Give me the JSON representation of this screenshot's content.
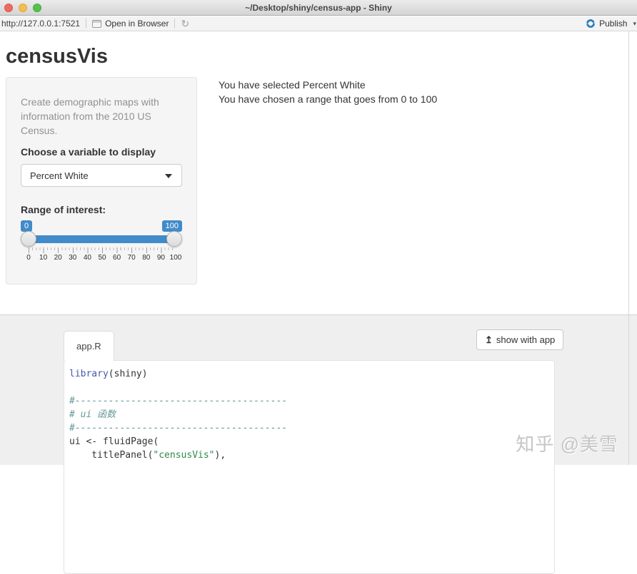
{
  "window": {
    "title": "~/Desktop/shiny/census-app - Shiny"
  },
  "toolbar": {
    "url": "http://127.0.0.1:7521",
    "open_in_browser_label": "Open in Browser",
    "refresh_icon": "↻",
    "publish_label": "Publish",
    "publish_caret": "▾"
  },
  "app": {
    "title": "censusVis",
    "sidebar": {
      "help_text": "Create demographic maps with information from the 2010 US Census.",
      "choose_label": "Choose a variable to display",
      "select_value": "Percent White",
      "range_label": "Range of interest:",
      "slider": {
        "min_badge": "0",
        "max_badge": "100",
        "ticks": [
          "0",
          "10",
          "20",
          "30",
          "40",
          "50",
          "60",
          "70",
          "80",
          "90",
          "100"
        ]
      }
    },
    "main": {
      "selected_line": "You have selected Percent White",
      "range_line": "You have chosen a range that goes from 0 to 100"
    }
  },
  "code_section": {
    "tab_label": "app.R",
    "show_with_app_label": "show with app",
    "show_with_app_icon": "↥",
    "lines": [
      [
        {
          "t": "library",
          "c": "kw"
        },
        {
          "t": "(shiny)",
          "c": "pl"
        }
      ],
      [],
      [
        {
          "t": "#--------------------------------------",
          "c": "cm"
        }
      ],
      [
        {
          "t": "# ui 函数",
          "c": "cm"
        }
      ],
      [
        {
          "t": "#--------------------------------------",
          "c": "cm"
        }
      ],
      [
        {
          "t": "ui <- fluidPage(",
          "c": "pl"
        }
      ],
      [
        {
          "t": "    titlePanel(",
          "c": "pl"
        },
        {
          "t": "\"censusVis\"",
          "c": "st"
        },
        {
          "t": "),",
          "c": "pl"
        }
      ]
    ]
  },
  "watermark": "知乎 @美雪",
  "colors": {
    "accent": "#428bca",
    "publish_blue": "#2d7dbd",
    "keyword": "#4758a8",
    "string": "#2d8a4a",
    "comment": "#669999"
  }
}
